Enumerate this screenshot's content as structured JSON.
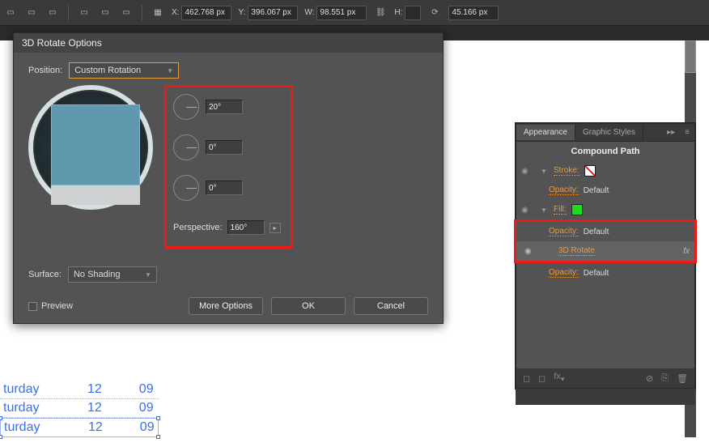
{
  "toolbar": {
    "x_label": "X:",
    "x_value": "462.768 px",
    "y_label": "Y:",
    "y_value": "396.067 px",
    "w_label": "W:",
    "w_value": "98.551 px",
    "h_label": "H:",
    "h_value": "",
    "rot_value": "45.166 px"
  },
  "dialog": {
    "title": "3D Rotate Options",
    "position_label": "Position:",
    "position_value": "Custom Rotation",
    "angle_x": "20°",
    "angle_y": "0°",
    "angle_z": "0°",
    "perspective_label": "Perspective:",
    "perspective_value": "160°",
    "surface_label": "Surface:",
    "surface_value": "No Shading",
    "preview_label": "Preview",
    "more_options": "More Options",
    "ok": "OK",
    "cancel": "Cancel"
  },
  "panel": {
    "tab_appearance": "Appearance",
    "tab_styles": "Graphic Styles",
    "header": "Compound Path",
    "stroke_label": "Stroke:",
    "opacity_label": "Opacity:",
    "default": "Default",
    "fill_label": "Fill:",
    "effect_3d": "3D Rotate",
    "fx": "fx"
  },
  "text_sample": {
    "day": "turday",
    "num1": "12",
    "num2": "09"
  }
}
